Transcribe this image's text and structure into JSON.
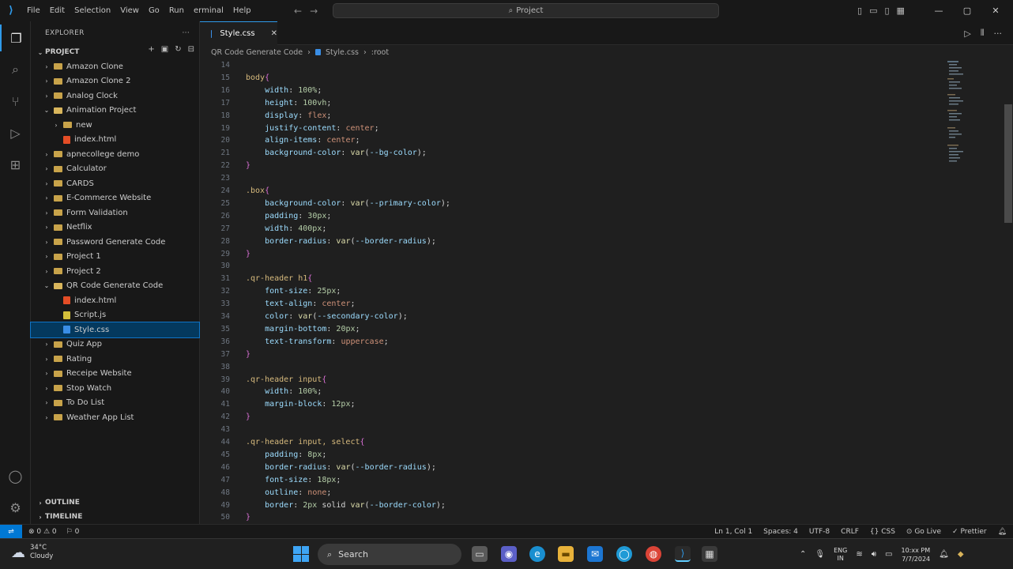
{
  "titlebar": {
    "menus": [
      "File",
      "Edit",
      "Selection",
      "View",
      "Go",
      "Run",
      "erminal",
      "Help"
    ],
    "command_center": "Project"
  },
  "sidebar": {
    "header": "EXPLORER",
    "header_more": "···",
    "project": "PROJECT",
    "items": [
      {
        "label": "Amazon Clone",
        "type": "folder",
        "depth": 1,
        "open": false
      },
      {
        "label": "Amazon Clone 2",
        "type": "folder",
        "depth": 1,
        "open": false
      },
      {
        "label": "Analog Clock",
        "type": "folder",
        "depth": 1,
        "open": false
      },
      {
        "label": "Animation Project",
        "type": "folder",
        "depth": 1,
        "open": true
      },
      {
        "label": "new",
        "type": "folder",
        "depth": 2,
        "open": false
      },
      {
        "label": "index.html",
        "type": "html",
        "depth": 2
      },
      {
        "label": "apnecollege demo",
        "type": "folder",
        "depth": 1,
        "open": false
      },
      {
        "label": "Calculator",
        "type": "folder",
        "depth": 1,
        "open": false
      },
      {
        "label": "CARDS",
        "type": "folder",
        "depth": 1,
        "open": false
      },
      {
        "label": "E-Commerce Website",
        "type": "folder",
        "depth": 1,
        "open": false
      },
      {
        "label": "Form Validation",
        "type": "folder",
        "depth": 1,
        "open": false
      },
      {
        "label": "Netflix",
        "type": "folder",
        "depth": 1,
        "open": false
      },
      {
        "label": "Password Generate Code",
        "type": "folder",
        "depth": 1,
        "open": false
      },
      {
        "label": "Project 1",
        "type": "folder",
        "depth": 1,
        "open": false
      },
      {
        "label": "Project 2",
        "type": "folder",
        "depth": 1,
        "open": false
      },
      {
        "label": "QR Code Generate Code",
        "type": "folder",
        "depth": 1,
        "open": true
      },
      {
        "label": "index.html",
        "type": "html",
        "depth": 2
      },
      {
        "label": "Script.js",
        "type": "js",
        "depth": 2
      },
      {
        "label": "Style.css",
        "type": "css",
        "depth": 2,
        "selected": true
      },
      {
        "label": "Quiz App",
        "type": "folder",
        "depth": 1,
        "open": false
      },
      {
        "label": "Rating",
        "type": "folder",
        "depth": 1,
        "open": false
      },
      {
        "label": "Receipe Website",
        "type": "folder",
        "depth": 1,
        "open": false
      },
      {
        "label": "Stop Watch",
        "type": "folder",
        "depth": 1,
        "open": false
      },
      {
        "label": "To Do List",
        "type": "folder",
        "depth": 1,
        "open": false
      },
      {
        "label": "Weather App List",
        "type": "folder",
        "depth": 1,
        "open": false
      }
    ],
    "outline": "OUTLINE",
    "timeline": "TIMELINE"
  },
  "editor": {
    "tab": "Style.css",
    "breadcrumb": [
      "QR Code Generate Code",
      "Style.css",
      ":root"
    ],
    "lines": [
      {
        "n": "14",
        "t": ""
      },
      {
        "n": "15",
        "t": "body{"
      },
      {
        "n": "16",
        "t": "    width: 100%;"
      },
      {
        "n": "17",
        "t": "    height: 100vh;"
      },
      {
        "n": "18",
        "t": "    display: flex;"
      },
      {
        "n": "19",
        "t": "    justify-content: center;"
      },
      {
        "n": "20",
        "t": "    align-items: center;"
      },
      {
        "n": "21",
        "t": "    background-color: var(--bg-color);"
      },
      {
        "n": "22",
        "t": "}"
      },
      {
        "n": "23",
        "t": ""
      },
      {
        "n": "24",
        "t": ".box{"
      },
      {
        "n": "25",
        "t": "    background-color: var(--primary-color);"
      },
      {
        "n": "26",
        "t": "    padding: 30px;"
      },
      {
        "n": "27",
        "t": "    width: 400px;"
      },
      {
        "n": "28",
        "t": "    border-radius: var(--border-radius);"
      },
      {
        "n": "29",
        "t": "}"
      },
      {
        "n": "30",
        "t": ""
      },
      {
        "n": "31",
        "t": ".qr-header h1{"
      },
      {
        "n": "32",
        "t": "    font-size: 25px;"
      },
      {
        "n": "33",
        "t": "    text-align: center;"
      },
      {
        "n": "34",
        "t": "    color: var(--secondary-color);"
      },
      {
        "n": "35",
        "t": "    margin-bottom: 20px;"
      },
      {
        "n": "36",
        "t": "    text-transform: uppercase;"
      },
      {
        "n": "37",
        "t": "}"
      },
      {
        "n": "38",
        "t": ""
      },
      {
        "n": "39",
        "t": ".qr-header input{"
      },
      {
        "n": "40",
        "t": "    width: 100%;"
      },
      {
        "n": "41",
        "t": "    margin-block: 12px;"
      },
      {
        "n": "42",
        "t": "}"
      },
      {
        "n": "43",
        "t": ""
      },
      {
        "n": "44",
        "t": ".qr-header input, select{"
      },
      {
        "n": "45",
        "t": "    padding: 8px;"
      },
      {
        "n": "46",
        "t": "    border-radius: var(--border-radius);"
      },
      {
        "n": "47",
        "t": "    font-size: 18px;"
      },
      {
        "n": "48",
        "t": "    outline: none;"
      },
      {
        "n": "49",
        "t": "    border: 2px solid var(--border-color);"
      },
      {
        "n": "50",
        "t": "}"
      }
    ]
  },
  "statusbar": {
    "problems": "⊗ 0 ⚠ 0",
    "ports": "⚐ 0",
    "position": "Ln 1, Col 1",
    "spaces": "Spaces: 4",
    "encoding": "UTF-8",
    "eol": "CRLF",
    "language": "{} CSS",
    "golive": "⊙ Go Live",
    "prettier": "✓ Prettier"
  },
  "taskbar": {
    "weather_temp": "34°C",
    "weather_desc": "Cloudy",
    "search": "Search",
    "lang1": "ENG",
    "lang2": "IN",
    "time": "10:xx PM",
    "date": "7/7/2024"
  },
  "colors": {
    "accent": "#0078d4",
    "selection": "#04395e"
  }
}
